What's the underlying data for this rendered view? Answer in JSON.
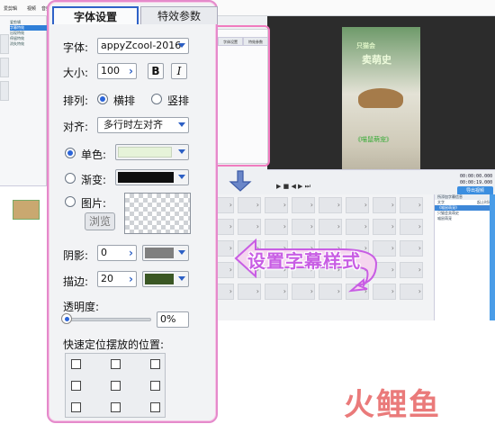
{
  "background_app": {
    "title_segments": [
      "爱剪辑",
      "视频",
      "音频"
    ],
    "timecode_current": "00:00:00.000",
    "timecode_total": "00:00:19.000",
    "export_label": "导出视频",
    "preview_title_top": "只猫会",
    "preview_title_main": "卖萌史",
    "preview_bottom_caption": "《喵鼠萌宠》",
    "left_tree_items": [
      "爱剪辑",
      "字幕特效",
      "出现特效",
      "停留特效",
      "消失特效",
      "",
      "",
      "",
      "",
      "",
      "",
      "",
      "",
      "",
      ""
    ],
    "right_list_header": "所添加字幕信息",
    "right_list_cols": [
      "文字",
      "起止时间"
    ],
    "right_list_rows": [
      "《喵鼠萌宠》",
      "只猫会卖萌史",
      "喵鼠萌宠"
    ],
    "mini_tabs": [
      "字体设置",
      "特效参数"
    ]
  },
  "dialog": {
    "tabs": {
      "font_settings": "字体设置",
      "effect_params": "特效参数"
    },
    "font_label": "字体:",
    "font_value": "appyZcool-2016",
    "size_label": "大小:",
    "size_value": "100",
    "bold_label": "B",
    "italic_label": "I",
    "layout_label": "排列:",
    "layout_horizontal": "横排",
    "layout_vertical": "竖排",
    "align_label": "对齐:",
    "align_value": "多行时左对齐",
    "solid_label": "单色:",
    "gradient_label": "渐变:",
    "image_label": "图片:",
    "browse_label": "浏览",
    "shadow_label": "阴影:",
    "shadow_value": "0",
    "stroke_label": "描边:",
    "stroke_value": "20",
    "opacity_label": "透明度:",
    "opacity_value": "0%",
    "position_label": "快速定位摆放的位置:",
    "colors": {
      "solid": "#e6f3d9",
      "gradient": "#0f0f0f",
      "shadow": "#7f7f7f",
      "stroke": "#3b5724"
    }
  },
  "callout": {
    "text": "设置字幕样式"
  },
  "watermark": {
    "text": "火鲤鱼"
  }
}
